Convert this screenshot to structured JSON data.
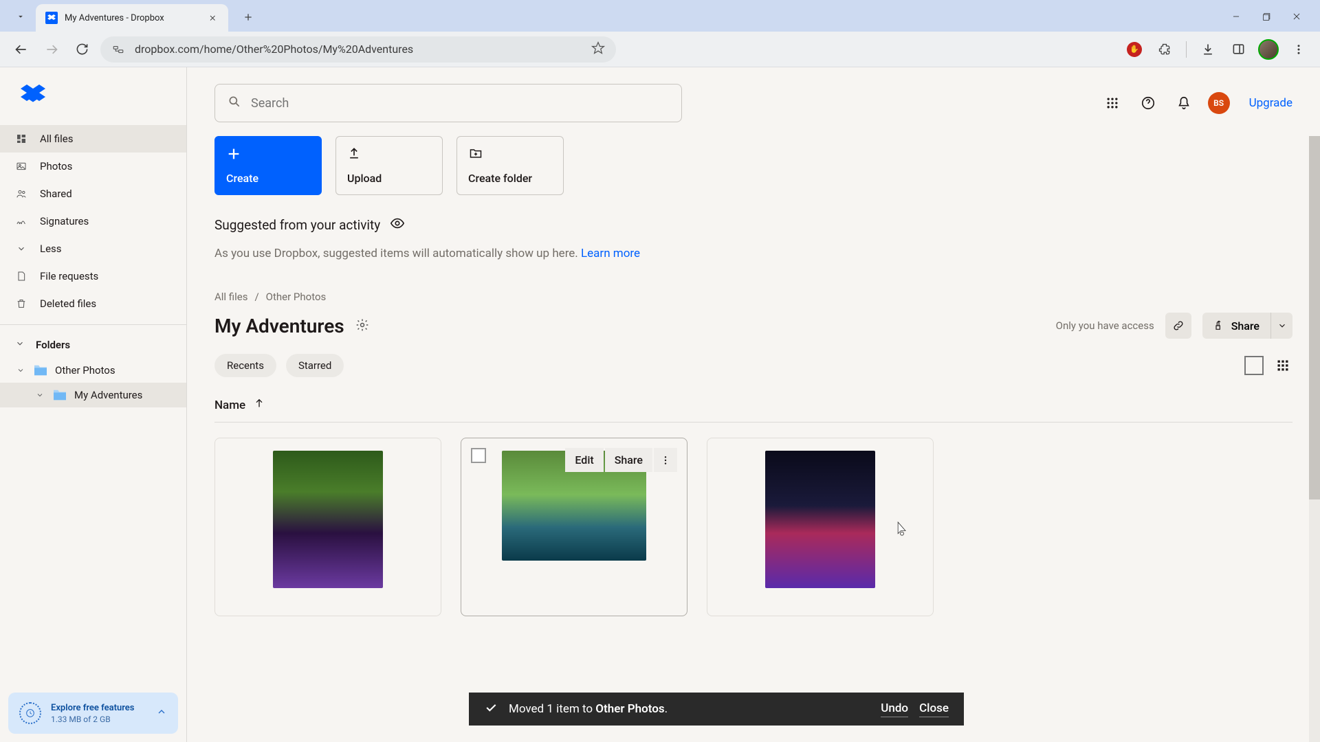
{
  "browser": {
    "tab_title": "My Adventures - Dropbox",
    "url": "dropbox.com/home/Other%20Photos/My%20Adventures"
  },
  "sidebar": {
    "items": [
      {
        "label": "All files",
        "icon": "grid"
      },
      {
        "label": "Photos",
        "icon": "photo"
      },
      {
        "label": "Shared",
        "icon": "people"
      },
      {
        "label": "Signatures",
        "icon": "signature"
      },
      {
        "label": "Less",
        "icon": "chevron"
      },
      {
        "label": "File requests",
        "icon": "file"
      },
      {
        "label": "Deleted files",
        "icon": "trash"
      }
    ],
    "folders_label": "Folders",
    "tree": [
      {
        "label": "Other Photos"
      },
      {
        "label": "My Adventures"
      }
    ],
    "explore": {
      "title": "Explore free features",
      "subtitle": "1.33 MB of 2 GB"
    }
  },
  "search": {
    "placeholder": "Search"
  },
  "header": {
    "avatar_initials": "BS",
    "upgrade": "Upgrade"
  },
  "actions": {
    "create": "Create",
    "upload": "Upload",
    "create_folder": "Create folder"
  },
  "suggested": {
    "title": "Suggested from your activity",
    "subtitle": "As you use Dropbox, suggested items will automatically show up here. ",
    "learn_more": "Learn more"
  },
  "breadcrumbs": [
    "All files",
    "Other Photos"
  ],
  "folder": {
    "title": "My Adventures",
    "access": "Only you have access",
    "share": "Share"
  },
  "chips": {
    "recents": "Recents",
    "starred": "Starred"
  },
  "table": {
    "name_col": "Name"
  },
  "hover": {
    "edit": "Edit",
    "share": "Share"
  },
  "toast": {
    "prefix": "Moved 1 item to ",
    "target": "Other Photos",
    "suffix": ".",
    "undo": "Undo",
    "close": "Close"
  }
}
